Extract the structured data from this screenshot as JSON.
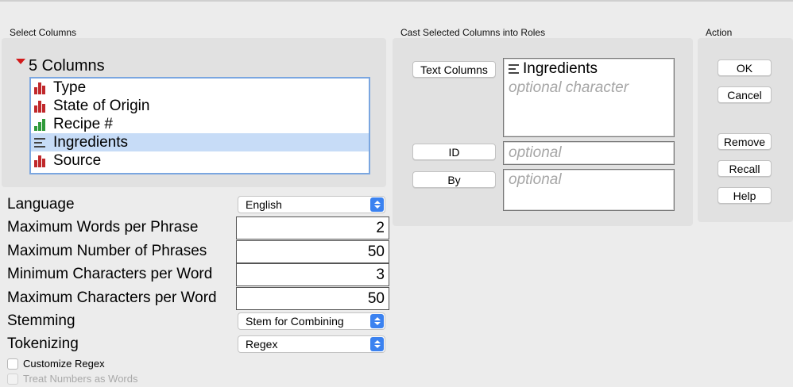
{
  "sections": {
    "select_columns": "Select Columns",
    "cast_roles": "Cast Selected Columns into Roles",
    "action": "Action"
  },
  "columns": {
    "header": "5 Columns",
    "items": [
      {
        "label": "Type",
        "icon": "nominal-icon"
      },
      {
        "label": "State of Origin",
        "icon": "nominal-icon"
      },
      {
        "label": "Recipe #",
        "icon": "continuous-icon"
      },
      {
        "label": "Ingredients",
        "icon": "text-icon",
        "selected": true
      },
      {
        "label": "Source",
        "icon": "nominal-icon"
      }
    ]
  },
  "options": {
    "language_label": "Language",
    "language_value": "English",
    "max_words_label": "Maximum Words per Phrase",
    "max_words_value": "2",
    "max_phrases_label": "Maximum Number of Phrases",
    "max_phrases_value": "50",
    "min_chars_label": "Minimum Characters per Word",
    "min_chars_value": "3",
    "max_chars_label": "Maximum Characters per Word",
    "max_chars_value": "50",
    "stemming_label": "Stemming",
    "stemming_value": "Stem for Combining",
    "tokenizing_label": "Tokenizing",
    "tokenizing_value": "Regex",
    "customize_regex_label": "Customize Regex",
    "treat_numbers_label": "Treat Numbers as Words"
  },
  "roles": {
    "text_columns_button": "Text Columns",
    "text_columns_value": "Ingredients",
    "text_columns_placeholder": "optional character",
    "id_button": "ID",
    "id_placeholder": "optional",
    "by_button": "By",
    "by_placeholder": "optional"
  },
  "actions": {
    "ok": "OK",
    "cancel": "Cancel",
    "remove": "Remove",
    "recall": "Recall",
    "help": "Help"
  },
  "colors": {
    "selection": "#c7dcf7",
    "list_border": "#7aa6e0",
    "nominal": "#c0282b",
    "continuous": "#2f9a3a",
    "select_arrow": "#3b82f0"
  }
}
